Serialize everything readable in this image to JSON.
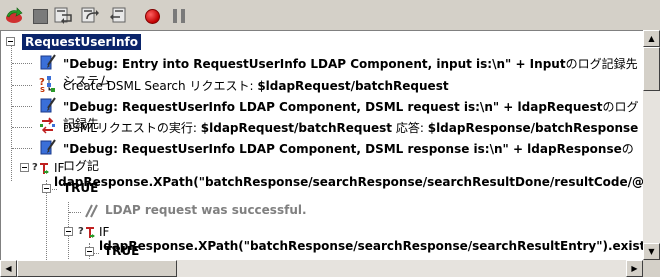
{
  "toolbar": {
    "buttons": [
      {
        "icon": "refresh-icon"
      },
      {
        "icon": "stop-icon"
      },
      {
        "icon": "step-into-icon"
      },
      {
        "icon": "step-over-icon"
      },
      {
        "icon": "step-out-icon"
      },
      {
        "icon": "breakpoint-icon"
      },
      {
        "icon": "pause-icon"
      }
    ]
  },
  "tree": {
    "root": "RequestUserInfo",
    "rows": [
      {
        "icon": "trace-icon",
        "parts": [
          {
            "t": "\"Debug: Entry into RequestUserInfo LDAP Component, input is:\\n\" + Input",
            "b": true
          },
          {
            "t": "のログ記録先 システム",
            "b": false
          }
        ]
      },
      {
        "icon": "create-dsml-icon",
        "parts": [
          {
            "t": "Create DSML Search リクエスト: ",
            "b": false
          },
          {
            "t": "$ldapRequest/batchRequest",
            "b": true
          }
        ]
      },
      {
        "icon": "trace-icon",
        "parts": [
          {
            "t": "\"Debug: RequestUserInfo LDAP Component, DSML request is:\\n\" + ldapRequest",
            "b": true
          },
          {
            "t": "のログ記録先",
            "b": false
          }
        ]
      },
      {
        "icon": "execute-dsml-icon",
        "parts": [
          {
            "t": "DSMLリクエストの実行: ",
            "b": false
          },
          {
            "t": "$ldapRequest/batchRequest",
            "b": true
          },
          {
            "t": " 応答: ",
            "b": false
          },
          {
            "t": "$ldapResponse/batchResponse",
            "b": true
          }
        ]
      },
      {
        "icon": "trace-icon",
        "parts": [
          {
            "t": "\"Debug: RequestUserInfo LDAP Component, DSML response is:\\n\" + ldapResponse",
            "b": true
          },
          {
            "t": "のログ記",
            "b": false
          }
        ]
      },
      {
        "icon": "if-icon",
        "parts": [
          {
            "t": "IF ",
            "b": false
          },
          {
            "t": "ldapResponse.XPath(\"batchResponse/searchResponse/searchResultDone/resultCode/@",
            "b": true
          }
        ]
      },
      {
        "icon": "",
        "parts": [
          {
            "t": "TRUE",
            "b": true
          }
        ]
      },
      {
        "icon": "comment-icon",
        "parts": [
          {
            "t": "LDAP request was successful.",
            "b": true,
            "c": true
          }
        ]
      },
      {
        "icon": "if-icon",
        "parts": [
          {
            "t": "IF ",
            "b": false
          },
          {
            "t": "ldapResponse.XPath(\"batchResponse/searchResponse/searchResultEntry\").exist",
            "b": true
          }
        ]
      },
      {
        "icon": "",
        "parts": [
          {
            "t": "TRUE",
            "b": true
          }
        ]
      }
    ]
  }
}
